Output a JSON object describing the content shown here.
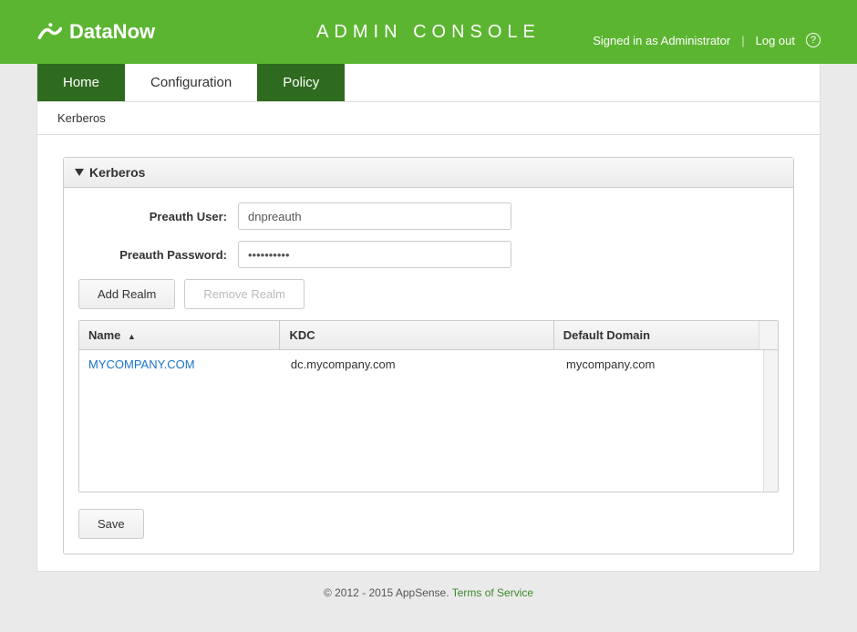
{
  "header": {
    "brand": "DataNow",
    "app_title": "ADMIN CONSOLE",
    "signed_in": "Signed in as Administrator",
    "logout": "Log out"
  },
  "tabs": {
    "home": "Home",
    "configuration": "Configuration",
    "policy": "Policy"
  },
  "breadcrumb": "Kerberos",
  "panel": {
    "title": "Kerberos",
    "preauth_user_label": "Preauth User:",
    "preauth_user_value": "dnpreauth",
    "preauth_password_label": "Preauth Password:",
    "preauth_password_value": "••••••••••",
    "add_realm": "Add Realm",
    "remove_realm": "Remove Realm",
    "columns": {
      "name": "Name",
      "kdc": "KDC",
      "default_domain": "Default Domain"
    },
    "rows": [
      {
        "name": "MYCOMPANY.COM",
        "kdc": "dc.mycompany.com",
        "domain": "mycompany.com"
      }
    ],
    "save": "Save"
  },
  "footer": {
    "copyright": "© 2012 - 2015 AppSense. ",
    "tos": "Terms of Service"
  }
}
